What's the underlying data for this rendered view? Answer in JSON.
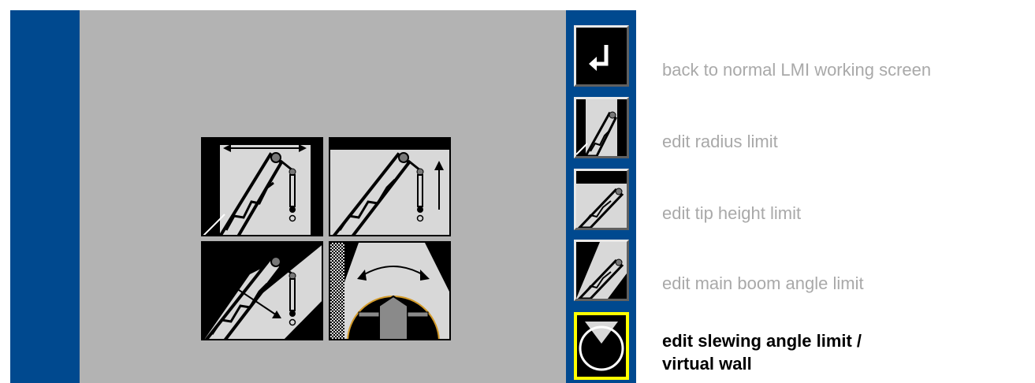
{
  "colors": {
    "screen_background": "#b3b3b3",
    "side_bar": "#00498f",
    "button_face": "#000000",
    "active_highlight": "#ffff00",
    "label_inactive": "#a9a9a9",
    "label_active": "#000000"
  },
  "icons": {
    "radius": "radius-limit-icon",
    "tip_height": "tip-height-limit-icon",
    "boom_angle": "boom-angle-limit-icon",
    "slewing": "slewing-angle-limit-icon",
    "back": "return-arrow-icon"
  },
  "menu": {
    "buttons": [
      {
        "id": "back",
        "label": "back to normal LMI working screen",
        "active": false
      },
      {
        "id": "radius",
        "label": "edit radius limit",
        "active": false
      },
      {
        "id": "tip_height",
        "label": "edit tip height limit",
        "active": false
      },
      {
        "id": "boom_angle",
        "label": "edit main boom angle limit",
        "active": false
      },
      {
        "id": "slewing",
        "label": "edit slewing angle limit / virtual wall",
        "active": true
      }
    ]
  }
}
